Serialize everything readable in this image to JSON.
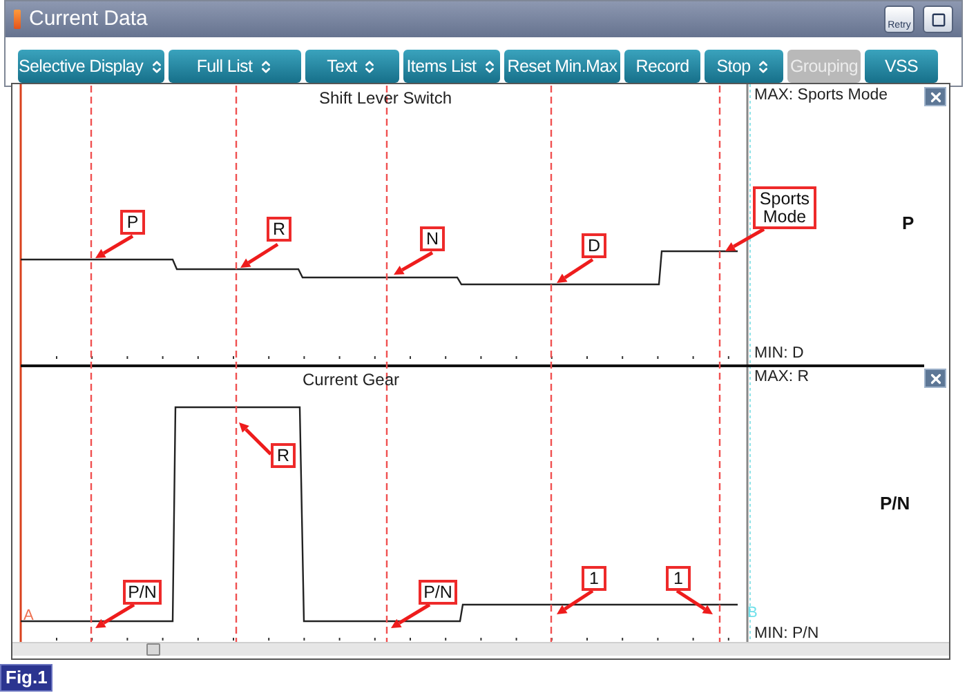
{
  "window": {
    "title": "Current Data",
    "retry_label": "Retry"
  },
  "toolbar": [
    {
      "label": "Selective Display",
      "kind": "dropdown",
      "disabled": false
    },
    {
      "label": "Full List",
      "kind": "dropdown",
      "disabled": false
    },
    {
      "label": "Text",
      "kind": "dropdown",
      "disabled": false
    },
    {
      "label": "Items List",
      "kind": "dropdown",
      "disabled": false
    },
    {
      "label": "Reset Min.Max",
      "kind": "button",
      "disabled": false
    },
    {
      "label": "Record",
      "kind": "button",
      "disabled": false
    },
    {
      "label": "Stop",
      "kind": "dropdown",
      "disabled": false
    },
    {
      "label": "Grouping",
      "kind": "button",
      "disabled": true
    },
    {
      "label": "VSS",
      "kind": "button",
      "disabled": false
    }
  ],
  "graphs": [
    {
      "title": "Shift Lever Switch",
      "max": "MAX: Sports Mode",
      "min": "MIN: D",
      "current": "P",
      "callouts": [
        "P",
        "R",
        "N",
        "D",
        "Sports Mode"
      ]
    },
    {
      "title": "Current Gear",
      "max": "MAX: R",
      "min": "MIN: P/N",
      "current": "P/N",
      "callouts": [
        "P/N",
        "R",
        "P/N",
        "1",
        "1"
      ],
      "cursor_labels": [
        "A",
        "B"
      ]
    }
  ],
  "figure_label": "Fig.1"
}
